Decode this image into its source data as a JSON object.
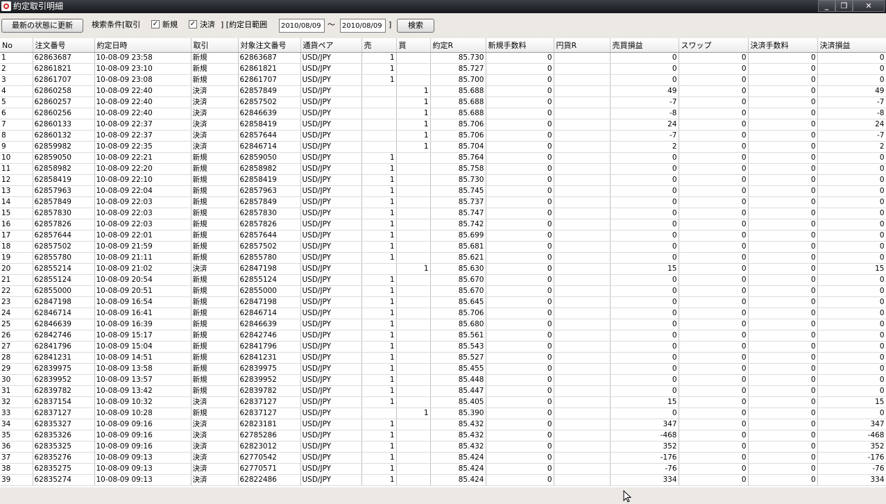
{
  "window": {
    "title": "約定取引明細",
    "min": "_",
    "max": "❐",
    "close": "✕"
  },
  "toolbar": {
    "refresh_label": "最新の状態に更新",
    "filter_label": "検索条件[取引",
    "new_label": "新規",
    "new_checked": true,
    "settle_label": "決済",
    "settle_checked": true,
    "range_label": "] [約定日範囲",
    "date_from": "2010/08/09",
    "tilde": "～",
    "date_to": "2010/08/09",
    "range_close": "]",
    "search_label": "検索"
  },
  "table": {
    "columns": [
      "No",
      "注文番号",
      "約定日時",
      "取引",
      "対象注文番号",
      "通貨ペア",
      "売",
      "買",
      "約定R",
      "新規手数料",
      "円貨R",
      "売買損益",
      "スワップ",
      "決済手数料",
      "決済損益"
    ],
    "rows": [
      [
        "1",
        "62863687",
        "10-08-09 23:58",
        "新規",
        "62863687",
        "USD/JPY",
        "1",
        "",
        "85.730",
        "0",
        "",
        "0",
        "0",
        "0",
        "0"
      ],
      [
        "2",
        "62861821",
        "10-08-09 23:10",
        "新規",
        "62861821",
        "USD/JPY",
        "1",
        "",
        "85.727",
        "0",
        "",
        "0",
        "0",
        "0",
        "0"
      ],
      [
        "3",
        "62861707",
        "10-08-09 23:08",
        "新規",
        "62861707",
        "USD/JPY",
        "1",
        "",
        "85.700",
        "0",
        "",
        "0",
        "0",
        "0",
        "0"
      ],
      [
        "4",
        "62860258",
        "10-08-09 22:40",
        "決済",
        "62857849",
        "USD/JPY",
        "",
        "1",
        "85.688",
        "0",
        "",
        "49",
        "0",
        "0",
        "49"
      ],
      [
        "5",
        "62860257",
        "10-08-09 22:40",
        "決済",
        "62857502",
        "USD/JPY",
        "",
        "1",
        "85.688",
        "0",
        "",
        "-7",
        "0",
        "0",
        "-7"
      ],
      [
        "6",
        "62860256",
        "10-08-09 22:40",
        "決済",
        "62846639",
        "USD/JPY",
        "",
        "1",
        "85.688",
        "0",
        "",
        "-8",
        "0",
        "0",
        "-8"
      ],
      [
        "7",
        "62860133",
        "10-08-09 22:37",
        "決済",
        "62858419",
        "USD/JPY",
        "",
        "1",
        "85.706",
        "0",
        "",
        "24",
        "0",
        "0",
        "24"
      ],
      [
        "8",
        "62860132",
        "10-08-09 22:37",
        "決済",
        "62857644",
        "USD/JPY",
        "",
        "1",
        "85.706",
        "0",
        "",
        "-7",
        "0",
        "0",
        "-7"
      ],
      [
        "9",
        "62859982",
        "10-08-09 22:35",
        "決済",
        "62846714",
        "USD/JPY",
        "",
        "1",
        "85.704",
        "0",
        "",
        "2",
        "0",
        "0",
        "2"
      ],
      [
        "10",
        "62859050",
        "10-08-09 22:21",
        "新規",
        "62859050",
        "USD/JPY",
        "1",
        "",
        "85.764",
        "0",
        "",
        "0",
        "0",
        "0",
        "0"
      ],
      [
        "11",
        "62858982",
        "10-08-09 22:20",
        "新規",
        "62858982",
        "USD/JPY",
        "1",
        "",
        "85.758",
        "0",
        "",
        "0",
        "0",
        "0",
        "0"
      ],
      [
        "12",
        "62858419",
        "10-08-09 22:10",
        "新規",
        "62858419",
        "USD/JPY",
        "1",
        "",
        "85.730",
        "0",
        "",
        "0",
        "0",
        "0",
        "0"
      ],
      [
        "13",
        "62857963",
        "10-08-09 22:04",
        "新規",
        "62857963",
        "USD/JPY",
        "1",
        "",
        "85.745",
        "0",
        "",
        "0",
        "0",
        "0",
        "0"
      ],
      [
        "14",
        "62857849",
        "10-08-09 22:03",
        "新規",
        "62857849",
        "USD/JPY",
        "1",
        "",
        "85.737",
        "0",
        "",
        "0",
        "0",
        "0",
        "0"
      ],
      [
        "15",
        "62857830",
        "10-08-09 22:03",
        "新規",
        "62857830",
        "USD/JPY",
        "1",
        "",
        "85.747",
        "0",
        "",
        "0",
        "0",
        "0",
        "0"
      ],
      [
        "16",
        "62857826",
        "10-08-09 22:03",
        "新規",
        "62857826",
        "USD/JPY",
        "1",
        "",
        "85.742",
        "0",
        "",
        "0",
        "0",
        "0",
        "0"
      ],
      [
        "17",
        "62857644",
        "10-08-09 22:01",
        "新規",
        "62857644",
        "USD/JPY",
        "1",
        "",
        "85.699",
        "0",
        "",
        "0",
        "0",
        "0",
        "0"
      ],
      [
        "18",
        "62857502",
        "10-08-09 21:59",
        "新規",
        "62857502",
        "USD/JPY",
        "1",
        "",
        "85.681",
        "0",
        "",
        "0",
        "0",
        "0",
        "0"
      ],
      [
        "19",
        "62855780",
        "10-08-09 21:11",
        "新規",
        "62855780",
        "USD/JPY",
        "1",
        "",
        "85.621",
        "0",
        "",
        "0",
        "0",
        "0",
        "0"
      ],
      [
        "20",
        "62855214",
        "10-08-09 21:02",
        "決済",
        "62847198",
        "USD/JPY",
        "",
        "1",
        "85.630",
        "0",
        "",
        "15",
        "0",
        "0",
        "15"
      ],
      [
        "21",
        "62855124",
        "10-08-09 20:54",
        "新規",
        "62855124",
        "USD/JPY",
        "1",
        "",
        "85.670",
        "0",
        "",
        "0",
        "0",
        "0",
        "0"
      ],
      [
        "22",
        "62855000",
        "10-08-09 20:51",
        "新規",
        "62855000",
        "USD/JPY",
        "1",
        "",
        "85.670",
        "0",
        "",
        "0",
        "0",
        "0",
        "0"
      ],
      [
        "23",
        "62847198",
        "10-08-09 16:54",
        "新規",
        "62847198",
        "USD/JPY",
        "1",
        "",
        "85.645",
        "0",
        "",
        "0",
        "0",
        "0",
        "0"
      ],
      [
        "24",
        "62846714",
        "10-08-09 16:41",
        "新規",
        "62846714",
        "USD/JPY",
        "1",
        "",
        "85.706",
        "0",
        "",
        "0",
        "0",
        "0",
        "0"
      ],
      [
        "25",
        "62846639",
        "10-08-09 16:39",
        "新規",
        "62846639",
        "USD/JPY",
        "1",
        "",
        "85.680",
        "0",
        "",
        "0",
        "0",
        "0",
        "0"
      ],
      [
        "26",
        "62842746",
        "10-08-09 15:17",
        "新規",
        "62842746",
        "USD/JPY",
        "1",
        "",
        "85.561",
        "0",
        "",
        "0",
        "0",
        "0",
        "0"
      ],
      [
        "27",
        "62841796",
        "10-08-09 15:04",
        "新規",
        "62841796",
        "USD/JPY",
        "1",
        "",
        "85.543",
        "0",
        "",
        "0",
        "0",
        "0",
        "0"
      ],
      [
        "28",
        "62841231",
        "10-08-09 14:51",
        "新規",
        "62841231",
        "USD/JPY",
        "1",
        "",
        "85.527",
        "0",
        "",
        "0",
        "0",
        "0",
        "0"
      ],
      [
        "29",
        "62839975",
        "10-08-09 13:58",
        "新規",
        "62839975",
        "USD/JPY",
        "1",
        "",
        "85.455",
        "0",
        "",
        "0",
        "0",
        "0",
        "0"
      ],
      [
        "30",
        "62839952",
        "10-08-09 13:57",
        "新規",
        "62839952",
        "USD/JPY",
        "1",
        "",
        "85.448",
        "0",
        "",
        "0",
        "0",
        "0",
        "0"
      ],
      [
        "31",
        "62839782",
        "10-08-09 13:42",
        "新規",
        "62839782",
        "USD/JPY",
        "1",
        "",
        "85.447",
        "0",
        "",
        "0",
        "0",
        "0",
        "0"
      ],
      [
        "32",
        "62837154",
        "10-08-09 10:32",
        "決済",
        "62837127",
        "USD/JPY",
        "1",
        "",
        "85.405",
        "0",
        "",
        "15",
        "0",
        "0",
        "15"
      ],
      [
        "33",
        "62837127",
        "10-08-09 10:28",
        "新規",
        "62837127",
        "USD/JPY",
        "",
        "1",
        "85.390",
        "0",
        "",
        "0",
        "0",
        "0",
        "0"
      ],
      [
        "34",
        "62835327",
        "10-08-09 09:16",
        "決済",
        "62823181",
        "USD/JPY",
        "1",
        "",
        "85.432",
        "0",
        "",
        "347",
        "0",
        "0",
        "347"
      ],
      [
        "35",
        "62835326",
        "10-08-09 09:16",
        "決済",
        "62785286",
        "USD/JPY",
        "1",
        "",
        "85.432",
        "0",
        "",
        "-468",
        "0",
        "0",
        "-468"
      ],
      [
        "36",
        "62835325",
        "10-08-09 09:16",
        "決済",
        "62823012",
        "USD/JPY",
        "1",
        "",
        "85.432",
        "0",
        "",
        "352",
        "0",
        "0",
        "352"
      ],
      [
        "37",
        "62835276",
        "10-08-09 09:13",
        "決済",
        "62770542",
        "USD/JPY",
        "1",
        "",
        "85.424",
        "0",
        "",
        "-176",
        "0",
        "0",
        "-176"
      ],
      [
        "38",
        "62835275",
        "10-08-09 09:13",
        "決済",
        "62770571",
        "USD/JPY",
        "1",
        "",
        "85.424",
        "0",
        "",
        "-76",
        "0",
        "0",
        "-76"
      ],
      [
        "39",
        "62835274",
        "10-08-09 09:13",
        "決済",
        "62822486",
        "USD/JPY",
        "1",
        "",
        "85.424",
        "0",
        "",
        "334",
        "0",
        "0",
        "334"
      ]
    ]
  }
}
